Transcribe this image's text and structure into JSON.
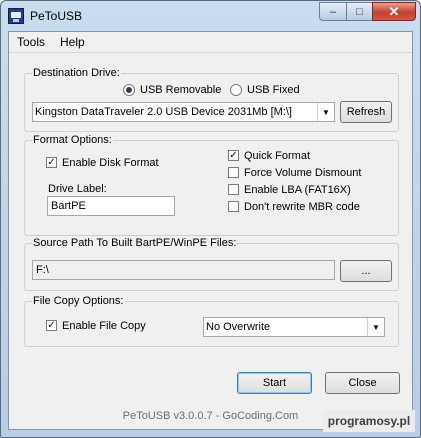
{
  "window": {
    "title": "PeToUSB"
  },
  "menu": {
    "items": [
      "Tools",
      "Help"
    ]
  },
  "destination": {
    "legend": "Destination Drive:",
    "usb_removable": {
      "label": "USB Removable",
      "selected": true
    },
    "usb_fixed": {
      "label": "USB Fixed",
      "selected": false
    },
    "drive_selected": "Kingston DataTraveler 2.0 USB Device 2031Mb [M:\\]",
    "refresh_label": "Refresh"
  },
  "format": {
    "legend": "Format Options:",
    "enable_disk_format": {
      "label": "Enable Disk Format",
      "checked": true
    },
    "drive_label_caption": "Drive Label:",
    "drive_label_value": "BartPE",
    "quick_format": {
      "label": "Quick Format",
      "checked": true
    },
    "force_dismount": {
      "label": "Force Volume Dismount",
      "checked": false
    },
    "enable_lba": {
      "label": "Enable LBA (FAT16X)",
      "checked": false
    },
    "dont_rewrite_mbr": {
      "label": "Don't rewrite MBR code",
      "checked": false
    }
  },
  "source": {
    "legend": "Source Path To Built BartPE/WinPE Files:",
    "path_value": "F:\\",
    "browse_label": "..."
  },
  "file_copy": {
    "legend": "File Copy Options:",
    "enable_file_copy": {
      "label": "Enable File Copy",
      "checked": true
    },
    "overwrite_selected": "No Overwrite"
  },
  "actions": {
    "start_label": "Start",
    "close_label": "Close"
  },
  "footer": {
    "text": "PeToUSB v3.0.0.7 - GoCoding.Com"
  },
  "watermark": {
    "text": "programosy.pl"
  }
}
